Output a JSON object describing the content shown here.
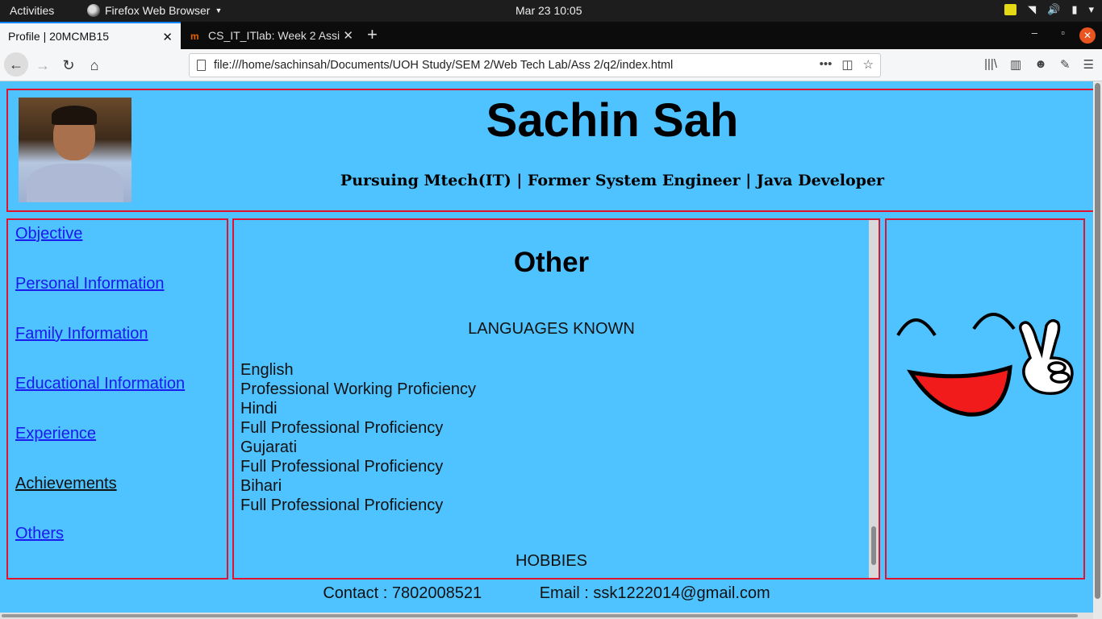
{
  "system_bar": {
    "activities": "Activities",
    "app_name": "Firefox Web Browser",
    "clock": "Mar 23  10:05"
  },
  "browser": {
    "tabs": [
      {
        "label": "Profile | 20MCMB15",
        "active": true
      },
      {
        "label": "CS_IT_ITlab: Week 2 Assi",
        "active": false
      }
    ],
    "url": "file:///home/sachinsah/Documents/UOH Study/SEM 2/Web Tech Lab/Ass 2/q2/index.html"
  },
  "header": {
    "name": "Sachin Sah",
    "tagline": "Pursuing Mtech(IT) | Former System Engineer | Java Developer"
  },
  "sidebar": {
    "links": [
      {
        "label": "Objective",
        "visited": false
      },
      {
        "label": "Personal Information",
        "visited": false
      },
      {
        "label": "Family Information",
        "visited": false
      },
      {
        "label": "Educational Information",
        "visited": false
      },
      {
        "label": "Experience",
        "visited": false
      },
      {
        "label": "Achievements",
        "visited": true
      },
      {
        "label": "Others",
        "visited": false
      }
    ]
  },
  "main": {
    "title": "Other",
    "languages_heading": "LANGUAGES KNOWN",
    "languages": [
      {
        "name": "English",
        "level": "Professional Working Proficiency"
      },
      {
        "name": "Hindi",
        "level": "Full Professional Proficiency"
      },
      {
        "name": "Gujarati",
        "level": "Full Professional Proficiency"
      },
      {
        "name": "Bihari",
        "level": "Full Professional Proficiency"
      }
    ],
    "hobbies_heading": "HOBBIES"
  },
  "footer": {
    "contact": "Contact : 7802008521",
    "email": "Email : ssk1222014@gmail.com"
  },
  "colors": {
    "page_background": "#4fc3ff",
    "border": "#e0142e",
    "link": "#1a1aee"
  }
}
